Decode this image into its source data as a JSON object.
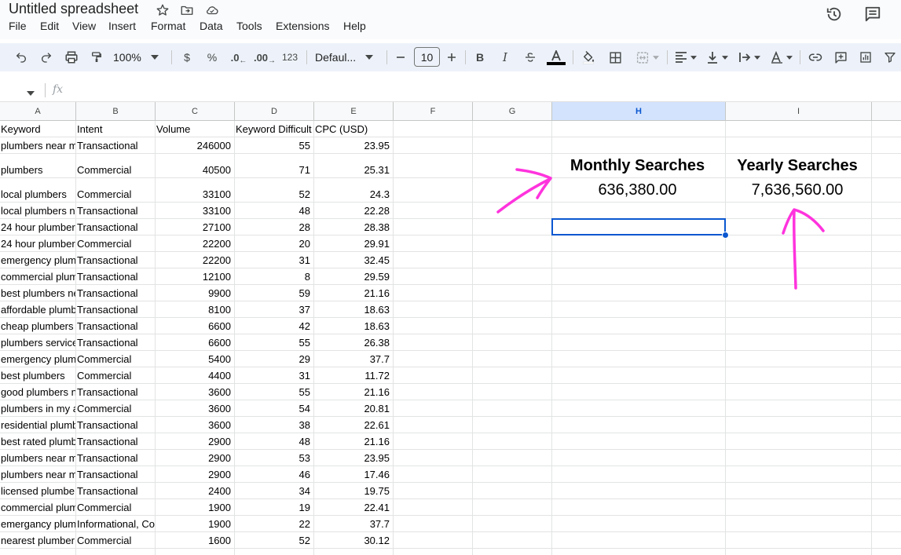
{
  "document": {
    "title": "Untitled spreadsheet"
  },
  "menu": [
    "File",
    "Edit",
    "View",
    "Insert",
    "Format",
    "Data",
    "Tools",
    "Extensions",
    "Help"
  ],
  "toolbar": {
    "zoom": "100%",
    "currency_label": "$",
    "percent_label": "%",
    "decrease_decimal_label": ".0",
    "increase_decimal_label": ".00",
    "number_format_label": "123",
    "font_family": "Defaul...",
    "font_size": "10",
    "bold_label": "B",
    "italic_label": "I"
  },
  "formula_bar": {
    "fx_label": "fx"
  },
  "columns": [
    "A",
    "B",
    "C",
    "D",
    "E",
    "F",
    "G",
    "H",
    "I"
  ],
  "table": {
    "headers": [
      "Keyword",
      "Intent",
      "Volume",
      "Keyword Difficult",
      "CPC (USD)"
    ],
    "rows": [
      [
        "plumbers near m",
        "Transactional",
        "246000",
        "55",
        "23.95"
      ],
      [
        "plumbers",
        "Commercial",
        "40500",
        "71",
        "25.31"
      ],
      [
        "local plumbers",
        "Commercial",
        "33100",
        "52",
        "24.3"
      ],
      [
        "local plumbers n",
        "Transactional",
        "33100",
        "48",
        "22.28"
      ],
      [
        "24 hour plumber",
        "Transactional",
        "27100",
        "28",
        "28.38"
      ],
      [
        "24 hour plumber",
        "Commercial",
        "22200",
        "20",
        "29.91"
      ],
      [
        "emergency plum",
        "Transactional",
        "22200",
        "31",
        "32.45"
      ],
      [
        "commercial plum",
        "Transactional",
        "12100",
        "8",
        "29.59"
      ],
      [
        "best plumbers ne",
        "Transactional",
        "9900",
        "59",
        "21.16"
      ],
      [
        "affordable plumb",
        "Transactional",
        "8100",
        "37",
        "18.63"
      ],
      [
        "cheap plumbers",
        "Transactional",
        "6600",
        "42",
        "18.63"
      ],
      [
        "plumbers service",
        "Transactional",
        "6600",
        "55",
        "26.38"
      ],
      [
        "emergency plum",
        "Commercial",
        "5400",
        "29",
        "37.7"
      ],
      [
        "best plumbers",
        "Commercial",
        "4400",
        "31",
        "11.72"
      ],
      [
        "good plumbers n",
        "Transactional",
        "3600",
        "55",
        "21.16"
      ],
      [
        "plumbers in my a",
        "Commercial",
        "3600",
        "54",
        "20.81"
      ],
      [
        "residential plumb",
        "Transactional",
        "3600",
        "38",
        "22.61"
      ],
      [
        "best rated plumb",
        "Transactional",
        "2900",
        "48",
        "21.16"
      ],
      [
        "plumbers near m",
        "Transactional",
        "2900",
        "53",
        "23.95"
      ],
      [
        "plumbers near m",
        "Transactional",
        "2900",
        "46",
        "17.46"
      ],
      [
        "licensed plumbe",
        "Transactional",
        "2400",
        "34",
        "19.75"
      ],
      [
        "commercial plum",
        "Commercial",
        "1900",
        "19",
        "22.41"
      ],
      [
        "emergancy plum",
        "Informational, Co",
        "1900",
        "22",
        "37.7"
      ],
      [
        "nearest plumber",
        "Commercial",
        "1600",
        "52",
        "30.12"
      ],
      [
        "",
        "",
        "",
        "",
        ""
      ]
    ]
  },
  "summary": {
    "monthly_label": "Monthly Searches",
    "monthly_value": "636,380.00",
    "yearly_label": "Yearly Searches",
    "yearly_value": "7,636,560.00"
  },
  "colors": {
    "accent": "#0b57d0",
    "annotation": "#ff33dd"
  }
}
